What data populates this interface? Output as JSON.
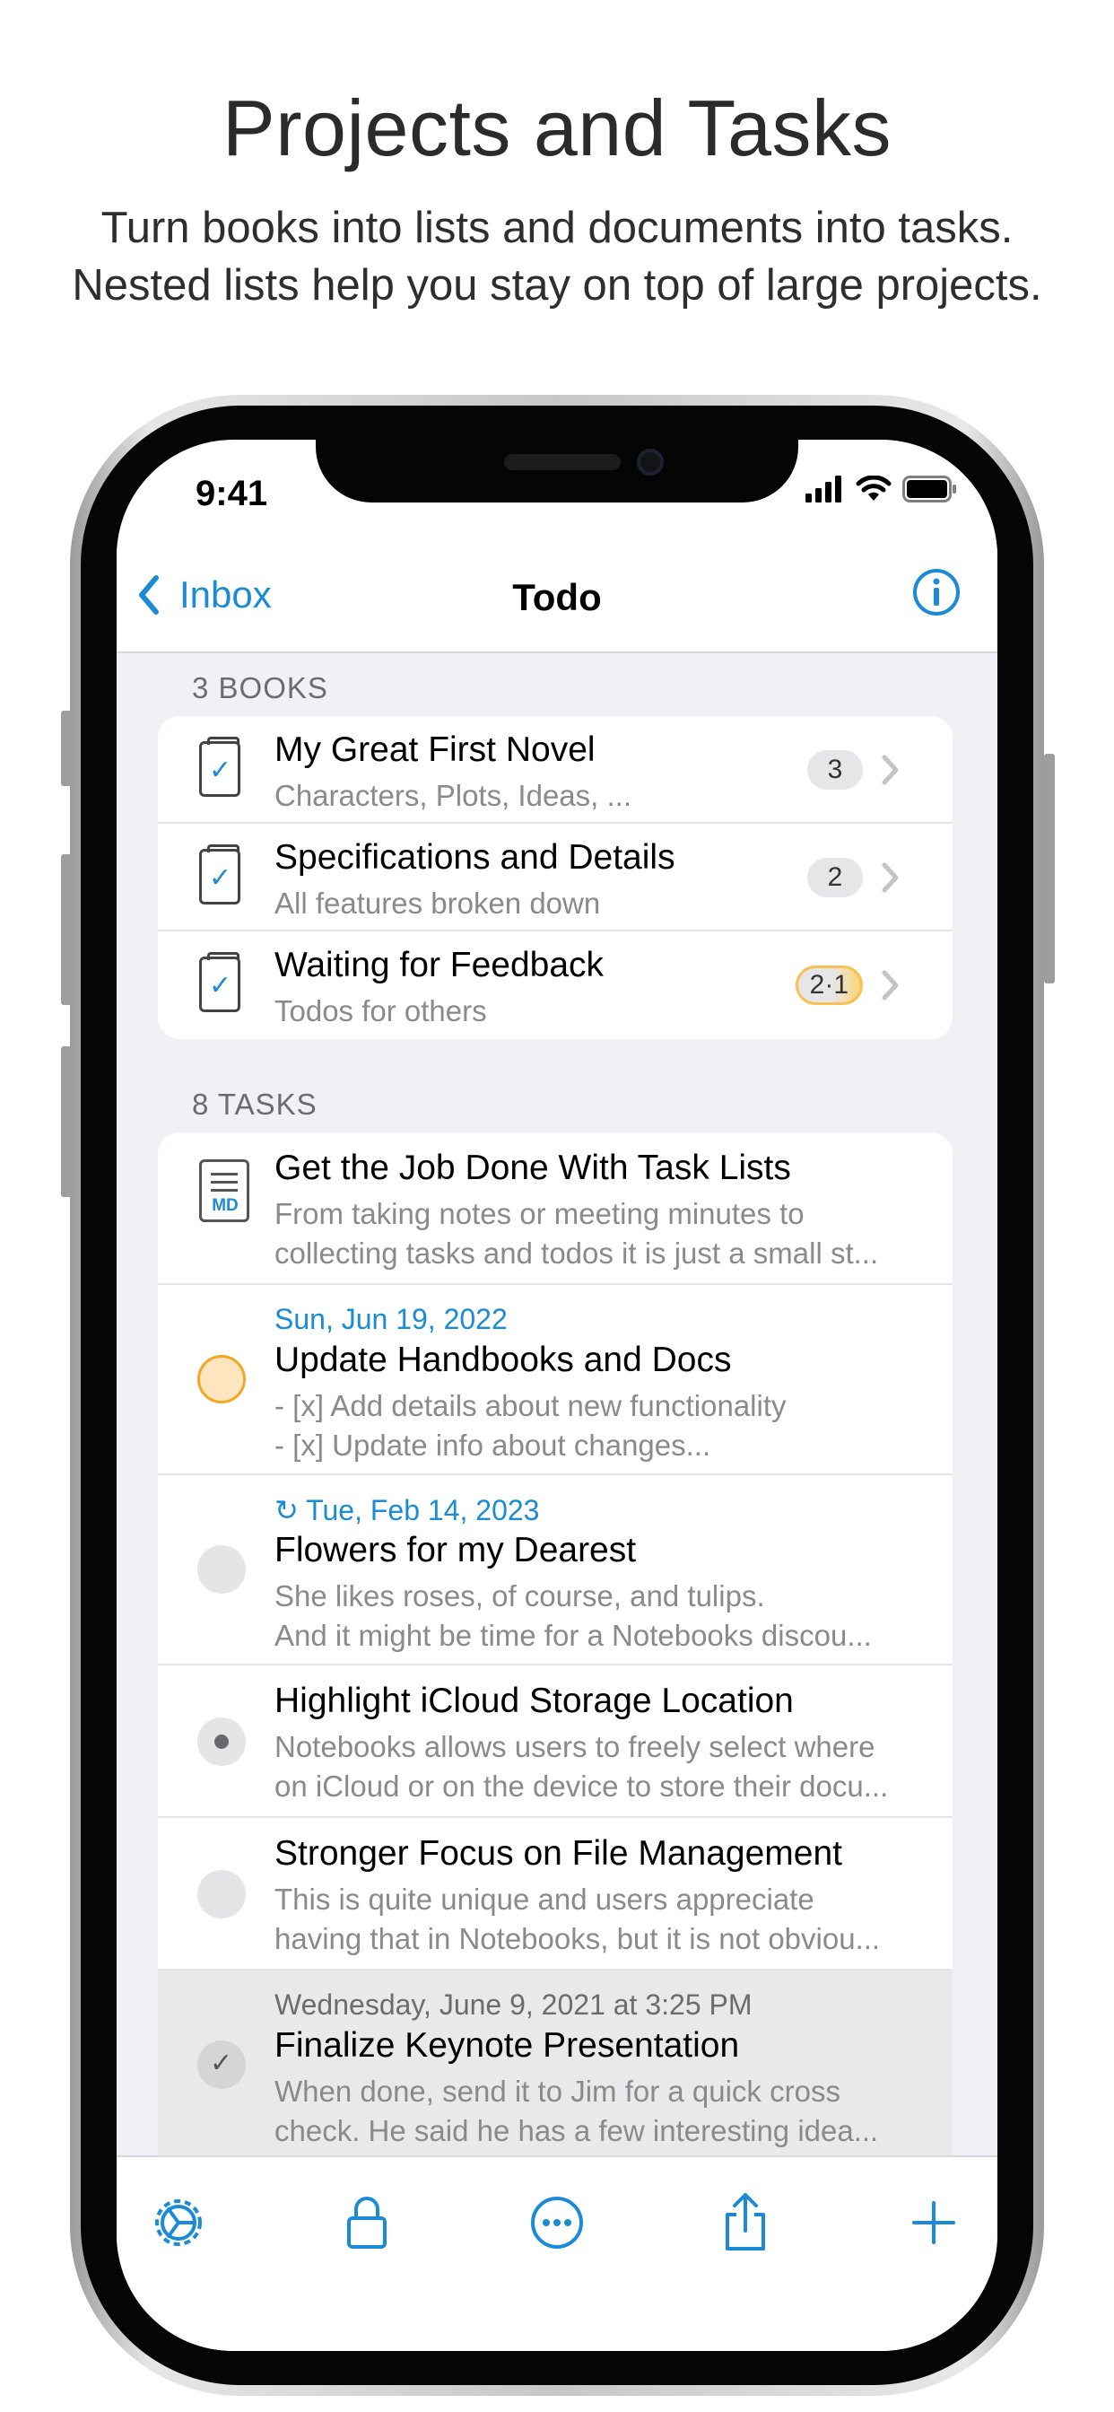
{
  "promo": {
    "headline": "Projects and Tasks",
    "subline_1": "Turn books into lists and documents into tasks.",
    "subline_2": "Nested lists help you stay on top of large projects."
  },
  "status_bar": {
    "time": "9:41",
    "icons": [
      "cellular-signal-icon",
      "wifi-icon",
      "battery-icon"
    ]
  },
  "nav": {
    "back_label": "Inbox",
    "title": "Todo",
    "info_icon": "info-icon"
  },
  "books_section": {
    "header": "3 BOOKS",
    "items": [
      {
        "title": "My Great First Novel",
        "subtitle": "Characters, Plots, Ideas, ...",
        "badge": "3",
        "badge_style": "gray"
      },
      {
        "title": "Specifications and Details",
        "subtitle": "All features broken down",
        "badge": "2",
        "badge_style": "gray"
      },
      {
        "title": "Waiting for Feedback",
        "subtitle": "Todos for others",
        "badge": "2·1",
        "badge_style": "orange"
      }
    ]
  },
  "tasks_section": {
    "header": "8 TASKS",
    "items": [
      {
        "kind": "markdown",
        "date": "",
        "title": "Get the Job Done With Task Lists",
        "line1": "From taking notes or meeting minutes to",
        "line2": "collecting tasks and todos it is just a small st..."
      },
      {
        "kind": "orange",
        "date": "Sun, Jun 19, 2022",
        "title": "Update Handbooks and Docs",
        "line1": "- [x] Add details about new functionality",
        "line2": "- [x] Update info about changes..."
      },
      {
        "kind": "empty",
        "date": "↻ Tue, Feb 14, 2023",
        "title": "Flowers for my Dearest",
        "line1": "She likes roses, of course, and tulips.",
        "line2": "And it might be time for a Notebooks discou..."
      },
      {
        "kind": "dot",
        "date": "",
        "title": "Highlight iCloud Storage Location",
        "line1": "Notebooks allows users to freely select where",
        "line2": "on iCloud or on the device to store their docu..."
      },
      {
        "kind": "empty",
        "date": "",
        "title": "Stronger Focus on File Management",
        "line1": "This is quite unique and users appreciate",
        "line2": "having that in Notebooks, but it is not obviou..."
      },
      {
        "kind": "done",
        "date": "Wednesday, June 9, 2021 at 3:25 PM",
        "title": "Finalize Keynote Presentation",
        "line1": "When done, send it to Jim for a quick cross",
        "line2": "check. He said he has a few interesting idea..."
      }
    ]
  },
  "toolbar": {
    "buttons": [
      "settings-icon",
      "lock-icon",
      "more-icon",
      "share-icon",
      "add-icon"
    ]
  },
  "colors": {
    "accent": "#1a8bd4",
    "orange": "#f5a623",
    "list_background": "#eff1f4"
  }
}
